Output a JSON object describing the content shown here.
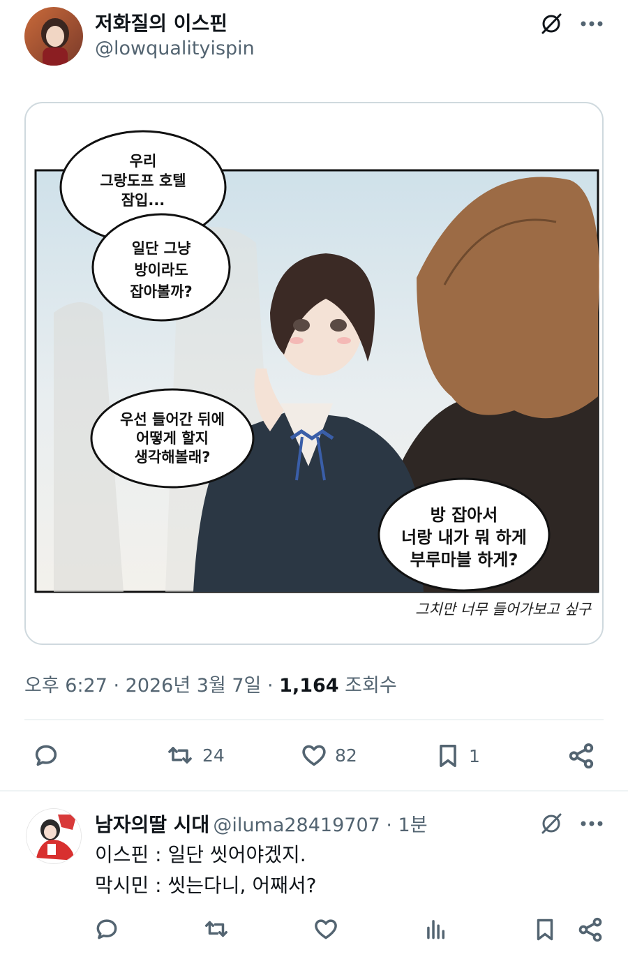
{
  "post": {
    "author_name": "저화질의 이스핀",
    "author_handle": "@lowqualityispin",
    "comic": {
      "bubbles": [
        [
          "우리",
          "그랑도프 호텔",
          "잠입..."
        ],
        [
          "일단 그냥",
          "방이라도",
          "잡아볼까?"
        ],
        [
          "우선 들어간 뒤에",
          "어떻게 할지",
          "생각해볼래?"
        ],
        [
          "방 잡아서",
          "너랑 내가 뭐 하게",
          "부루마블 하게?"
        ]
      ],
      "caption": "그치만 너무 들어가보고 싶구"
    },
    "timestamp": "오후 6:27 · 2026년 3월 7일 · ",
    "views_count": "1,164",
    "views_label": " 조회수",
    "actions": {
      "reposts": "24",
      "likes": "82",
      "bookmarks": "1"
    }
  },
  "reply": {
    "author_name": "남자의딸 시대",
    "author_handle": "@iluma28419707 · 1분",
    "lines": [
      "이스핀 : 일단 씻어야겠지.",
      "막시민 : 씻는다니, 어째서?"
    ]
  },
  "colors": {
    "accent_text": "#0f1419",
    "secondary_text": "#536471",
    "border": "#cfd9de"
  },
  "icons": [
    "grok-icon",
    "more-icon",
    "reply-icon",
    "repost-icon",
    "like-icon",
    "bookmark-icon",
    "share-icon",
    "views-icon"
  ]
}
